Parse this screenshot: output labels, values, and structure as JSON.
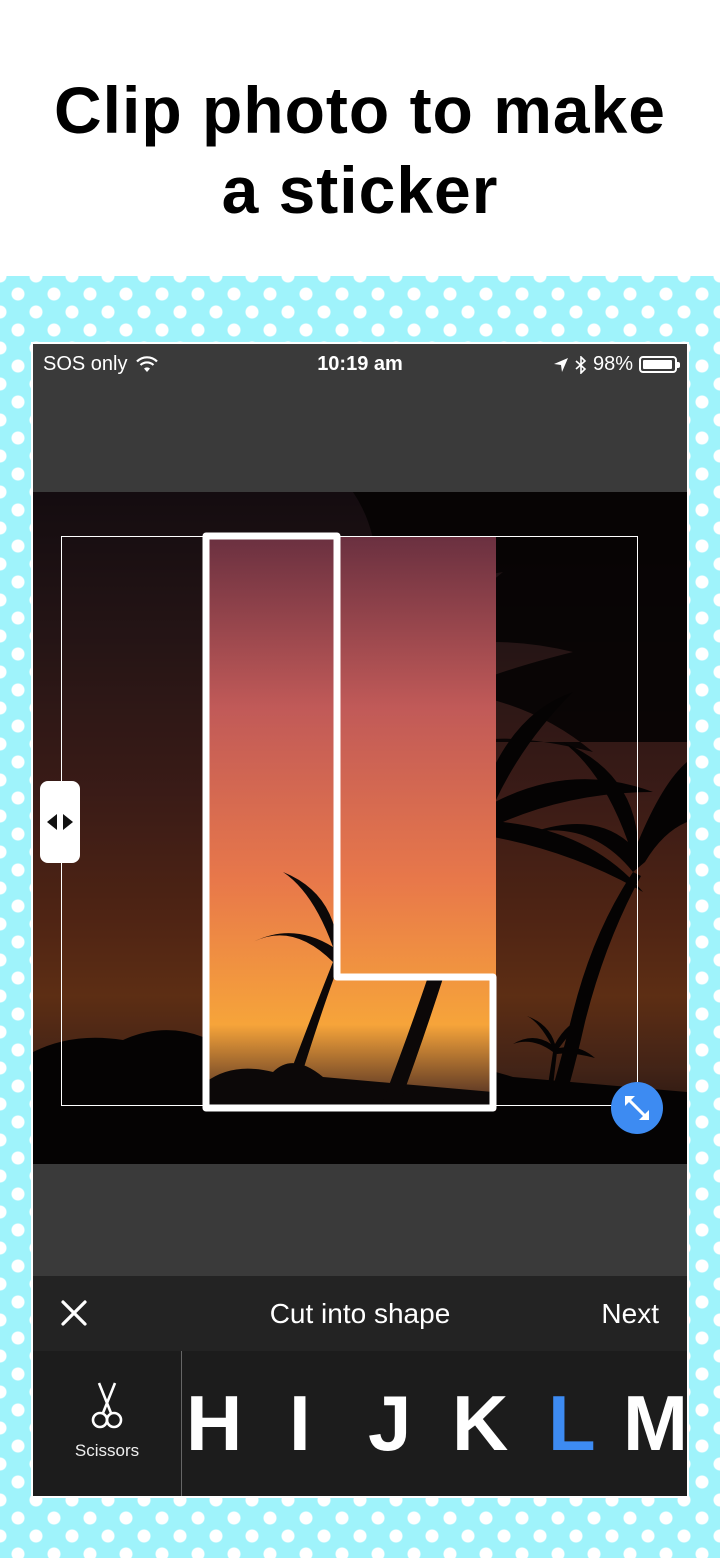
{
  "headline": {
    "line1": "Clip photo to make",
    "line2": "a sticker"
  },
  "status_bar": {
    "carrier": "SOS only",
    "time": "10:19 am",
    "battery": "98%"
  },
  "toolbar": {
    "title": "Cut into shape",
    "next_label": "Next"
  },
  "tools": {
    "scissors_label": "Scissors"
  },
  "letters": [
    "H",
    "I",
    "J",
    "K",
    "L",
    "M"
  ],
  "selected_letter": "L",
  "colors": {
    "accent": "#3d8bf2",
    "pattern_bg": "#9ff3fb",
    "toolbar_bg": "#232323",
    "editor_bg": "#3a3a3a"
  },
  "icons": [
    "wifi-icon",
    "location-icon",
    "bluetooth-icon",
    "battery-icon",
    "close-icon",
    "resize-icon",
    "horizontal-resize-icon",
    "scissors-icon"
  ]
}
